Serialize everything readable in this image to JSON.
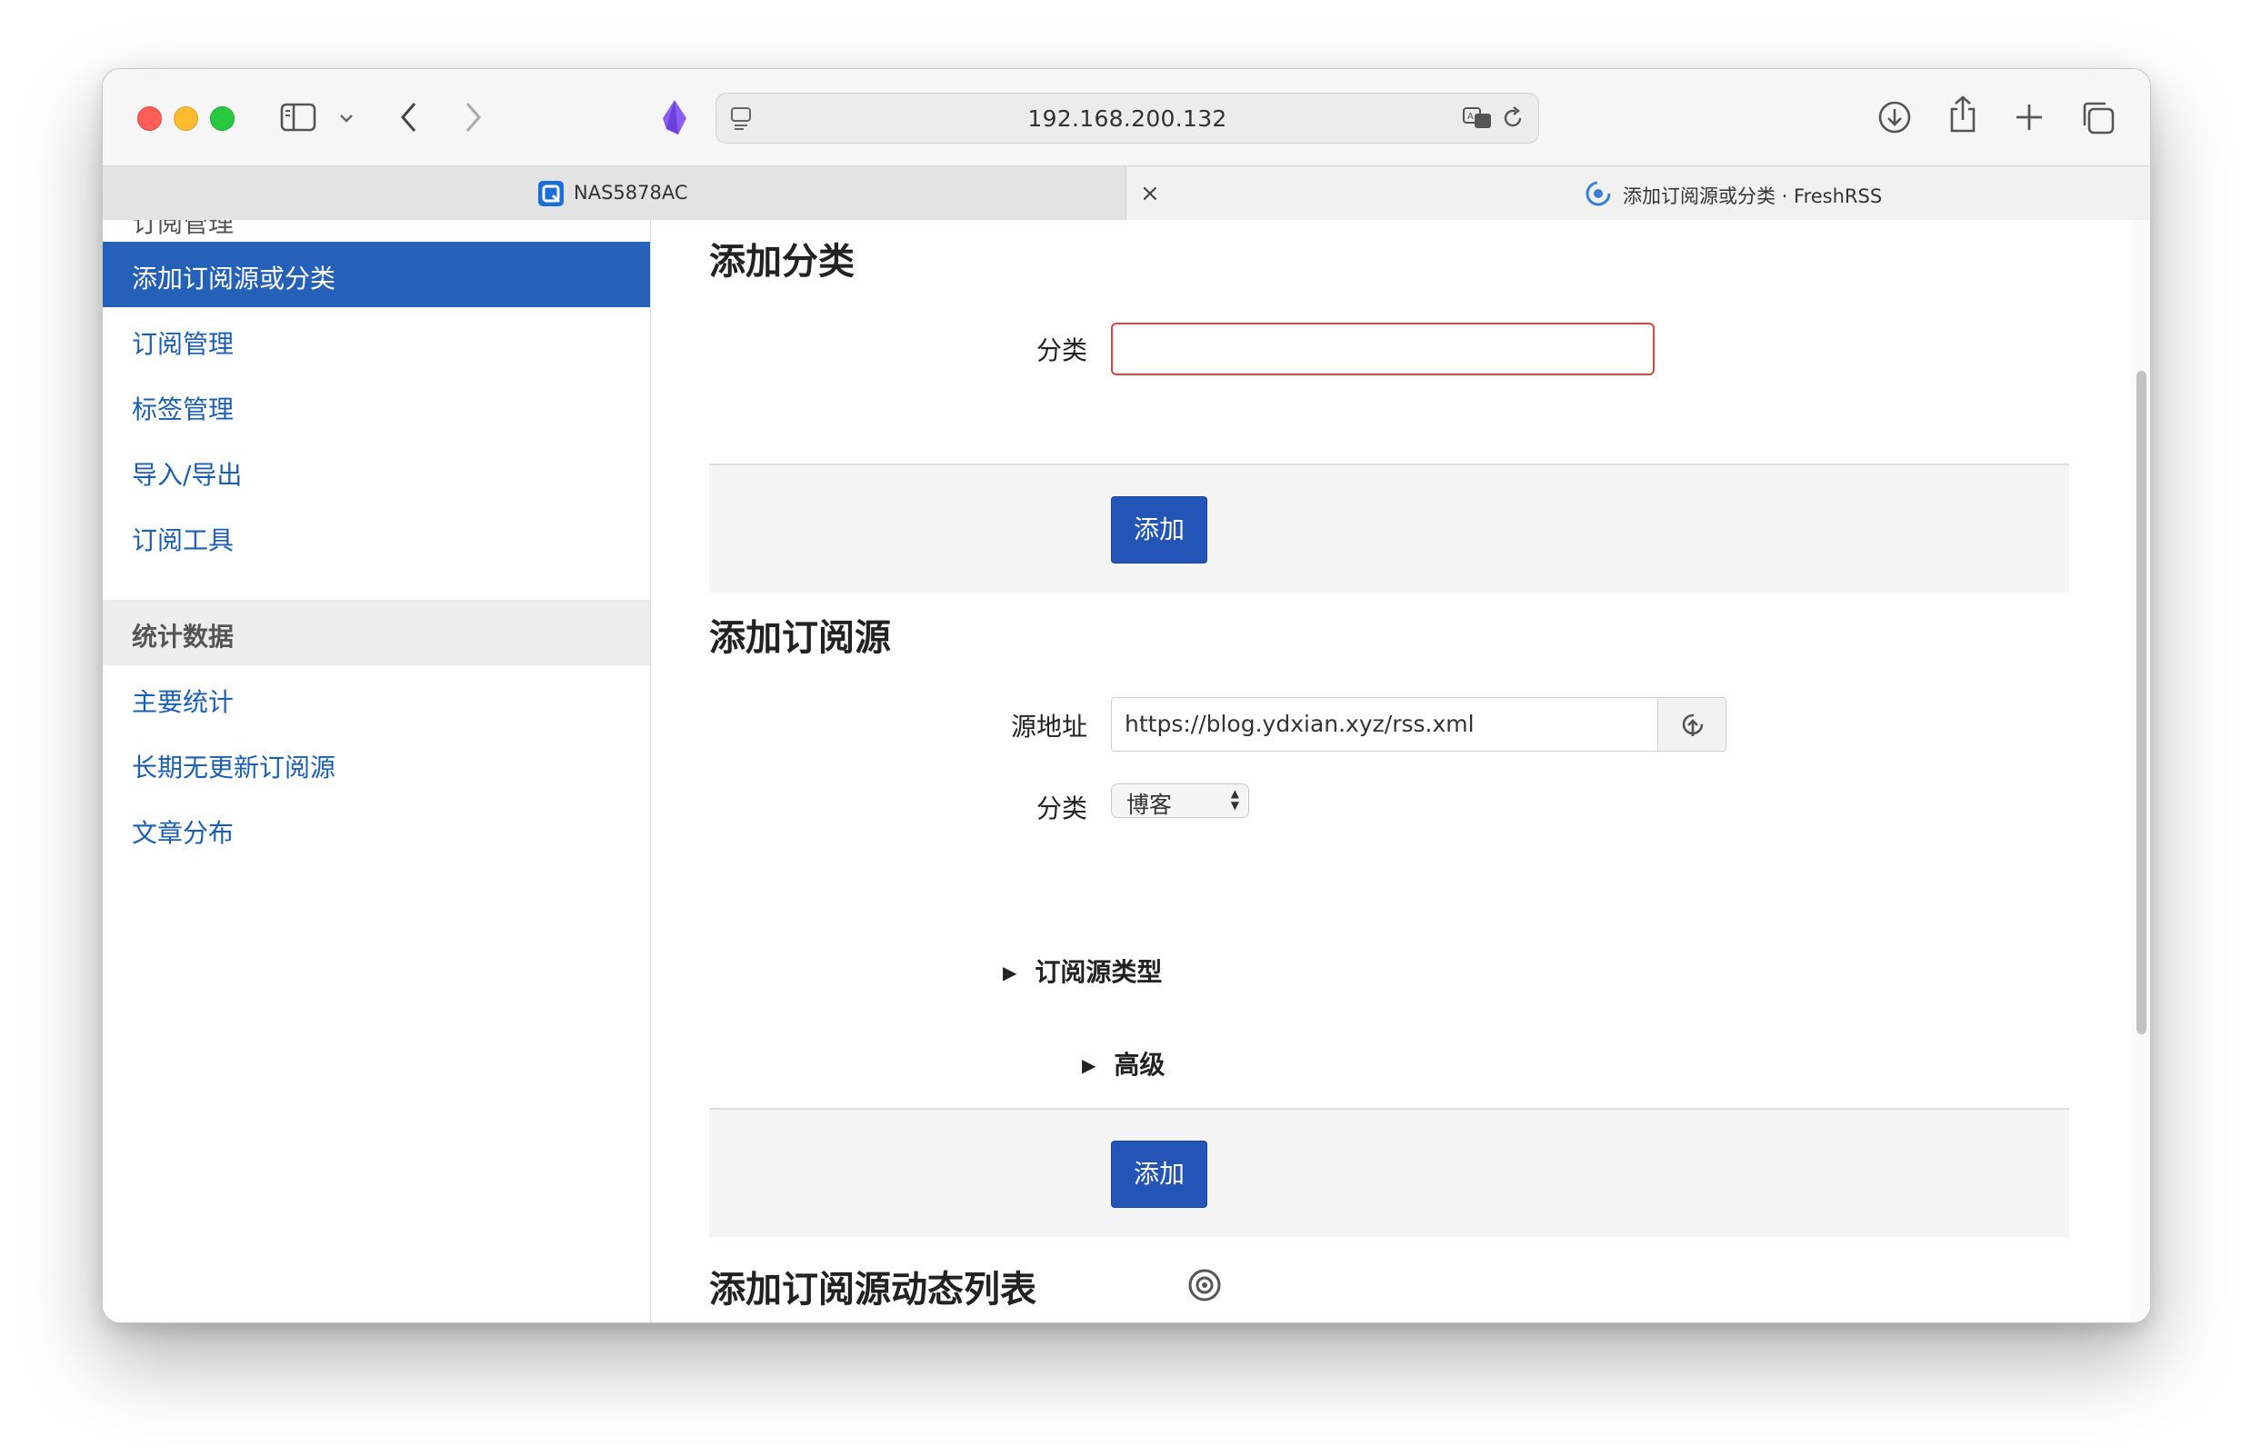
{
  "browser": {
    "address": "192.168.200.132",
    "tabs": [
      {
        "title": "NAS5878AC"
      },
      {
        "title": "添加订阅源或分类 · FreshRSS"
      }
    ],
    "tab_close": "×"
  },
  "sidebar": {
    "cutoff_text": "订阅管理",
    "items": [
      {
        "label": "添加订阅源或分类",
        "active": true
      },
      {
        "label": "订阅管理"
      },
      {
        "label": "标签管理"
      },
      {
        "label": "导入/导出"
      },
      {
        "label": "订阅工具"
      }
    ],
    "section_header": "统计数据",
    "stats_items": [
      {
        "label": "主要统计"
      },
      {
        "label": "长期无更新订阅源"
      },
      {
        "label": "文章分布"
      }
    ]
  },
  "add_category": {
    "title": "添加分类",
    "field_label": "分类",
    "value": "",
    "button": "添加"
  },
  "add_feed": {
    "title": "添加订阅源",
    "url_label": "源地址",
    "url_value": "https://blog.ydxian.xyz/rss.xml",
    "category_label": "分类",
    "category_value": "博客",
    "feed_type_summary": "订阅源类型",
    "advanced_summary": "高级",
    "button": "添加"
  },
  "add_dynamic": {
    "title": "添加订阅源动态列表"
  },
  "colors": {
    "accent": "#2255b6",
    "sidebar_active": "#2561b8",
    "link": "#1b5fb3",
    "error_border": "#e0423c"
  }
}
